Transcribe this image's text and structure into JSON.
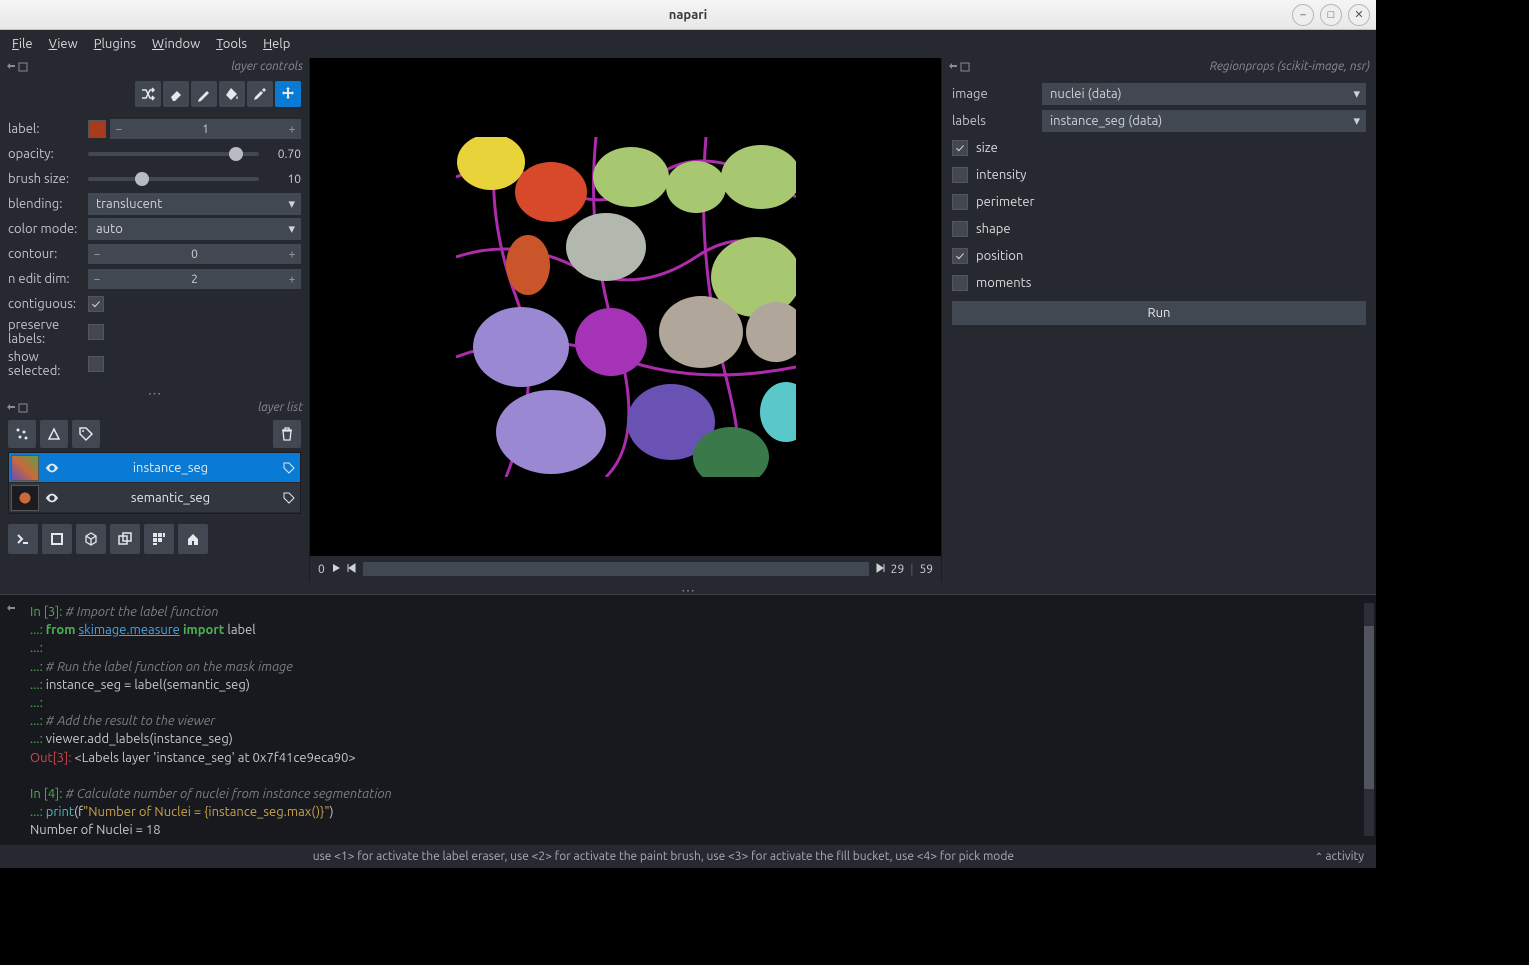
{
  "app_title": "napari",
  "menubar": [
    "File",
    "View",
    "Plugins",
    "Window",
    "Tools",
    "Help"
  ],
  "layer_controls": {
    "title": "layer controls",
    "label_lbl": "label:",
    "label_value": "1",
    "opacity_lbl": "opacity:",
    "opacity_value": "0.70",
    "brush_lbl": "brush size:",
    "brush_value": "10",
    "blending_lbl": "blending:",
    "blending_value": "translucent",
    "colormode_lbl": "color mode:",
    "colormode_value": "auto",
    "contour_lbl": "contour:",
    "contour_value": "0",
    "nedit_lbl": "n edit dim:",
    "nedit_value": "2",
    "contiguous_lbl": "contiguous:",
    "preserve_lbl": "preserve labels:",
    "show_lbl": "show selected:"
  },
  "layer_list": {
    "title": "layer list",
    "items": [
      {
        "name": "instance_seg",
        "selected": true
      },
      {
        "name": "semantic_seg",
        "selected": false
      }
    ]
  },
  "dim": {
    "current": "0",
    "pos": "29",
    "max": "59"
  },
  "regionprops": {
    "title": "Regionprops (scikit-image, nsr)",
    "image_lbl": "image",
    "image_value": "nuclei (data)",
    "labels_lbl": "labels",
    "labels_value": "instance_seg (data)",
    "checks": [
      {
        "name": "size",
        "on": true
      },
      {
        "name": "intensity",
        "on": false
      },
      {
        "name": "perimeter",
        "on": false
      },
      {
        "name": "shape",
        "on": false
      },
      {
        "name": "position",
        "on": true
      },
      {
        "name": "moments",
        "on": false
      }
    ],
    "run": "Run"
  },
  "console": {
    "in3": "In [3]:",
    "in3_c1": "# Import the label function",
    "in3_l2a": "from ",
    "in3_l2b": "skimage.measure",
    "in3_l2c": " import ",
    "in3_l2d": "label",
    "in3_c3": "# Run the label function on the mask image",
    "in3_l4": "instance_seg = label(semantic_seg)",
    "in3_c5": "# Add the result to the viewer",
    "in3_l6": "viewer.add_labels(instance_seg)",
    "out3": "Out[3]:",
    "out3_v": "<Labels layer 'instance_seg' at 0x7f41ce9eca90>",
    "in4": "In [4]:",
    "in4_c1": "# Calculate number of nuclei from instance segmentation",
    "in4_l2a": "print",
    "in4_l2b": "(f",
    "in4_l2c": "\"Number of Nuclei = {instance_seg.max()}\"",
    "in4_l2d": ")",
    "in4_out": "Number of Nuclei = 18",
    "cont": "   ...: "
  },
  "statusbar": {
    "hint": "use <1> for activate the label eraser, use <2> for activate the paint brush, use <3> for activate the fill bucket, use <4> for pick mode",
    "activity": "activity"
  }
}
